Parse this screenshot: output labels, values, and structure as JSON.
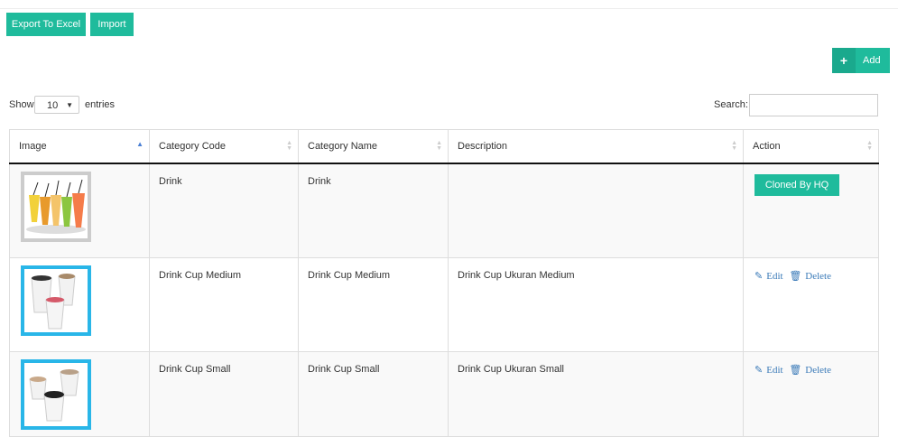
{
  "toolbar": {
    "export_label": "Export To Excel",
    "import_label": "Import",
    "add_label": "Add",
    "add_icon": "+"
  },
  "controls": {
    "show_label": "Show",
    "entries_value": "10",
    "entries_label": "entries",
    "search_label": "Search:",
    "search_value": ""
  },
  "table": {
    "headers": [
      "Image",
      "Category Code",
      "Category Name",
      "Description",
      "Action"
    ],
    "rows": [
      {
        "code": "Drink",
        "name": "Drink",
        "description": "",
        "action": "Cloned By HQ"
      },
      {
        "code": "Drink Cup Medium",
        "name": "Drink Cup Medium",
        "description": "Drink Cup Ukuran Medium",
        "edit": "Edit",
        "delete": "Delete"
      },
      {
        "code": "Drink Cup Small",
        "name": "Drink Cup Small",
        "description": "Drink Cup Ukuran Small",
        "edit": "Edit",
        "delete": "Delete"
      }
    ]
  },
  "colors": {
    "accent": "#1fbb9c",
    "link": "#3a7ab8",
    "thumb_border": "#29b6e8"
  }
}
